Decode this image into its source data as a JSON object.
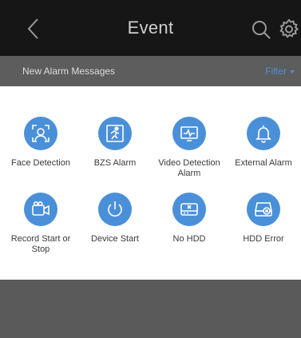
{
  "header": {
    "title": "Event",
    "back_icon": "chevron-left-icon",
    "search_icon": "search-icon",
    "settings_icon": "gear-icon"
  },
  "subbar": {
    "title": "New Alarm Messages",
    "filter_label": "Filter"
  },
  "alarm_types": [
    {
      "label": "Face Detection",
      "icon": "face-detection-icon"
    },
    {
      "label": "BZS Alarm",
      "icon": "running-person-icon"
    },
    {
      "label": "Video Detection Alarm",
      "icon": "monitor-waveform-icon"
    },
    {
      "label": "External Alarm",
      "icon": "bell-icon"
    },
    {
      "label": "Record Start or Stop",
      "icon": "video-camera-icon"
    },
    {
      "label": "Device Start",
      "icon": "power-icon"
    },
    {
      "label": "No HDD",
      "icon": "hdd-missing-icon"
    },
    {
      "label": "HDD Error",
      "icon": "hdd-error-icon"
    }
  ],
  "colors": {
    "header_bg": "#161616",
    "subbar_bg": "#5d5d5d",
    "accent": "#4a90d9",
    "filter": "#4d8fd6"
  }
}
